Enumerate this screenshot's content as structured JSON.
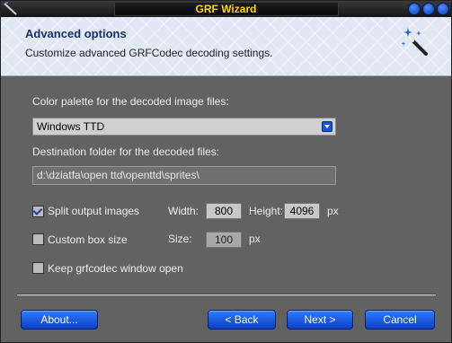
{
  "window": {
    "title": "GRF Wizard"
  },
  "header": {
    "title": "Advanced options",
    "subtitle": "Customize advanced GRFCodec decoding settings."
  },
  "palette": {
    "label": "Color palette for the decoded image files:",
    "selected": "Windows TTD"
  },
  "destination": {
    "label": "Destination folder for the decoded files:",
    "value": "d:\\dziatfa\\open ttd\\openttd\\sprites\\"
  },
  "split": {
    "label": "Split output images",
    "checked": true,
    "width_label": "Width:",
    "width_value": "800",
    "height_label": "Height:",
    "height_value": "4096",
    "unit": "px"
  },
  "custom_box": {
    "label": "Custom box size",
    "checked": false,
    "size_label": "Size:",
    "size_value": "100",
    "unit": "px"
  },
  "keep_open": {
    "label": "Keep grfcodec window open",
    "checked": false
  },
  "buttons": {
    "about": "About...",
    "back": "< Back",
    "next": "Next >",
    "cancel": "Cancel"
  },
  "icons": {
    "titlebar_left": "app-icon",
    "wand": "magic-wand-icon"
  },
  "colors": {
    "title_text": "#ffd400",
    "panel_bg": "#626262",
    "header_bg": "#dfe8f3",
    "button_blue": "#1a56d8"
  }
}
